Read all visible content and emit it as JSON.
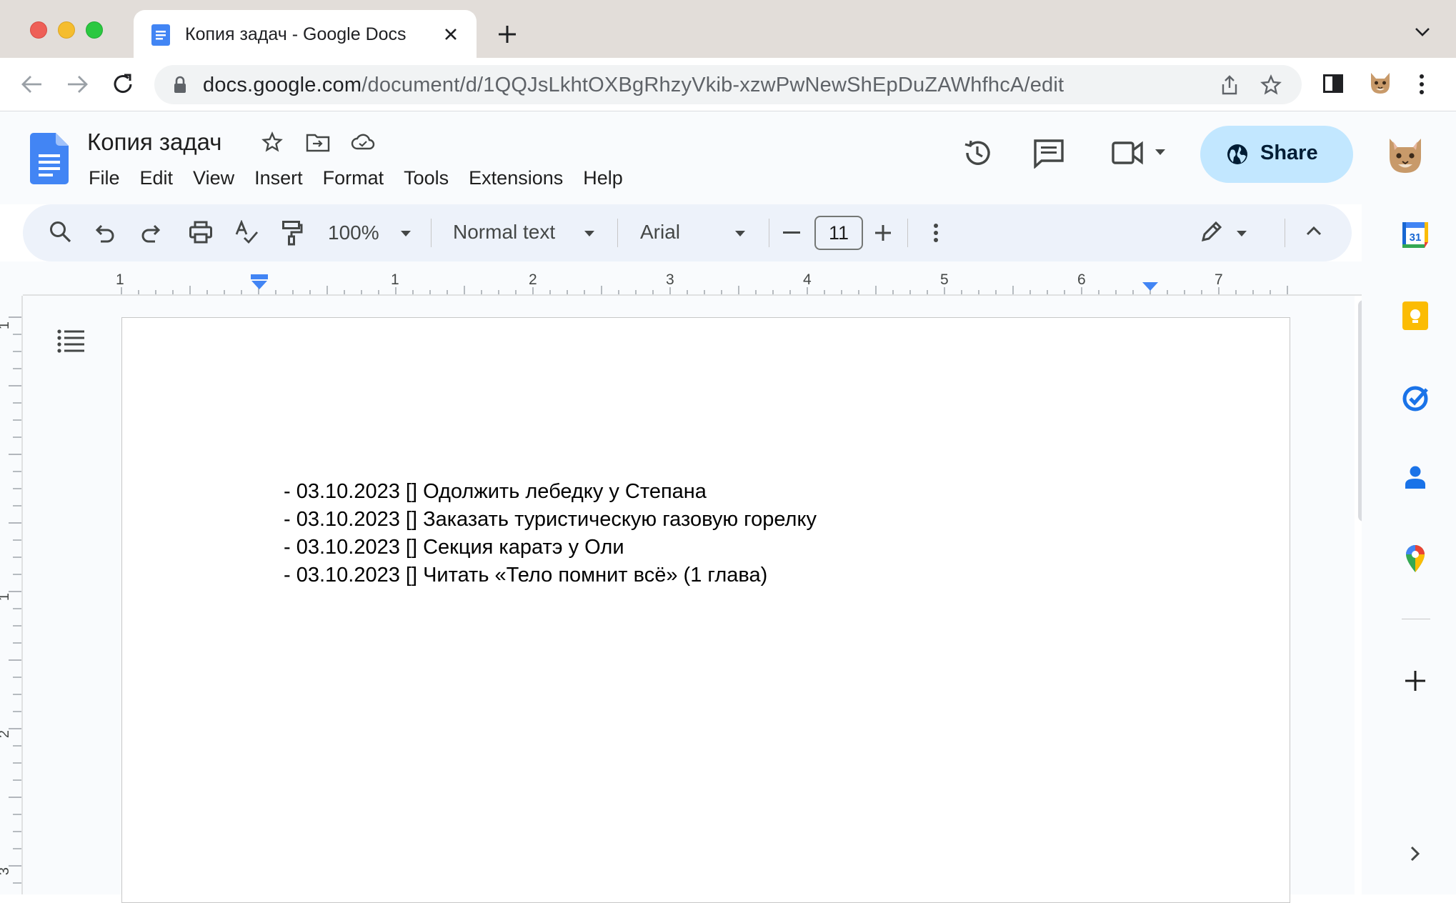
{
  "browser": {
    "tab": {
      "title": "Копия задач - Google Docs",
      "favicon": "docs-icon"
    },
    "url": {
      "host": "docs.google.com",
      "path": "/document/d/1QQJsLkhtOXBgRhzyVkib-xzwPwNewShEpDuZAWhfhcA/edit"
    }
  },
  "docs": {
    "title": "Копия задач",
    "menu": [
      "File",
      "Edit",
      "View",
      "Insert",
      "Format",
      "Tools",
      "Extensions",
      "Help"
    ],
    "share_label": "Share"
  },
  "toolbar": {
    "zoom": "100%",
    "paragraph_style": "Normal text",
    "font": "Arial",
    "font_size": "11"
  },
  "ruler": {
    "h_labels": [
      "1",
      "1",
      "2",
      "3",
      "4",
      "5",
      "6",
      "7"
    ],
    "v_labels": [
      "1",
      "1",
      "2",
      "3"
    ]
  },
  "document": {
    "lines": [
      "- 03.10.2023 [] Одолжить лебедку у Степана",
      "- 03.10.2023 [] Заказать туристическую газовую горелку",
      "- 03.10.2023 [] Секция каратэ у Оли",
      "- 03.10.2023 [] Читать «Тело помнит всё» (1 глава)"
    ]
  },
  "side_panel": {
    "calendar_day": "31",
    "apps": [
      "calendar-icon",
      "keep-icon",
      "tasks-icon",
      "contacts-icon",
      "maps-icon",
      "add-icon",
      "expand-icon"
    ]
  },
  "colors": {
    "tab_strip": "#e2ddd9",
    "share_button": "#c2e7ff",
    "toolbar_bg": "#edf2fa",
    "docs_blue": "#4285f4"
  }
}
